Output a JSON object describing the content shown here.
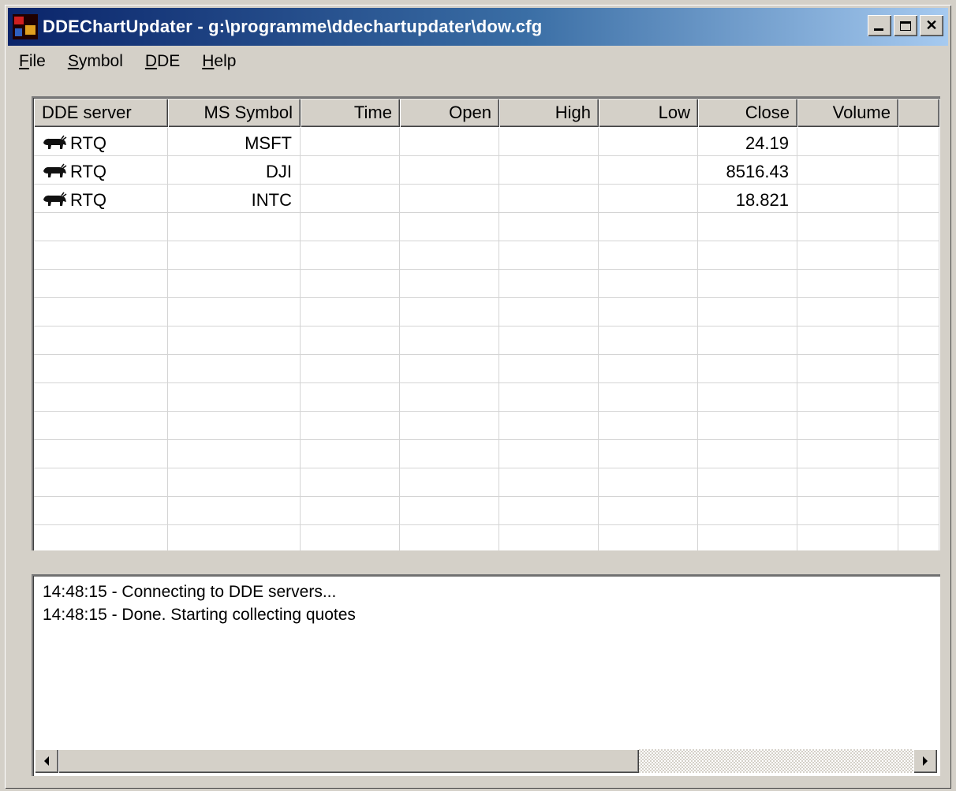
{
  "window": {
    "title": "DDEChartUpdater - g:\\programme\\ddechartupdater\\dow.cfg",
    "app_icon": "ddechartupdater-icon",
    "caption_buttons": {
      "minimize": "minimize-icon",
      "maximize": "maximize-icon",
      "close": "close-icon",
      "close_label": "✕"
    }
  },
  "menu": {
    "items": [
      {
        "underline": "F",
        "rest": "ile"
      },
      {
        "underline": "S",
        "rest": "ymbol"
      },
      {
        "underline": "D",
        "rest": "DE"
      },
      {
        "underline": "H",
        "rest": "elp"
      }
    ]
  },
  "table": {
    "columns": [
      "DDE server",
      "MS Symbol",
      "Time",
      "Open",
      "High",
      "Low",
      "Close",
      "Volume",
      ""
    ],
    "rows": [
      {
        "icon": "bull-icon",
        "server": "RTQ",
        "symbol": "MSFT",
        "time": "",
        "open": "",
        "high": "",
        "low": "",
        "close": "24.19",
        "volume": ""
      },
      {
        "icon": "bull-icon",
        "server": "RTQ",
        "symbol": "DJI",
        "time": "",
        "open": "",
        "high": "",
        "low": "",
        "close": "8516.43",
        "volume": ""
      },
      {
        "icon": "bull-icon",
        "server": "RTQ",
        "symbol": "INTC",
        "time": "",
        "open": "",
        "high": "",
        "low": "",
        "close": "18.821",
        "volume": ""
      }
    ]
  },
  "log": {
    "lines": [
      "14:48:15 - Connecting to DDE servers...",
      "14:48:15 - Done. Starting collecting quotes"
    ]
  },
  "colors": {
    "title_bar_start": "#0a246a",
    "title_bar_end": "#a6caf0",
    "face": "#d4d0c8"
  }
}
